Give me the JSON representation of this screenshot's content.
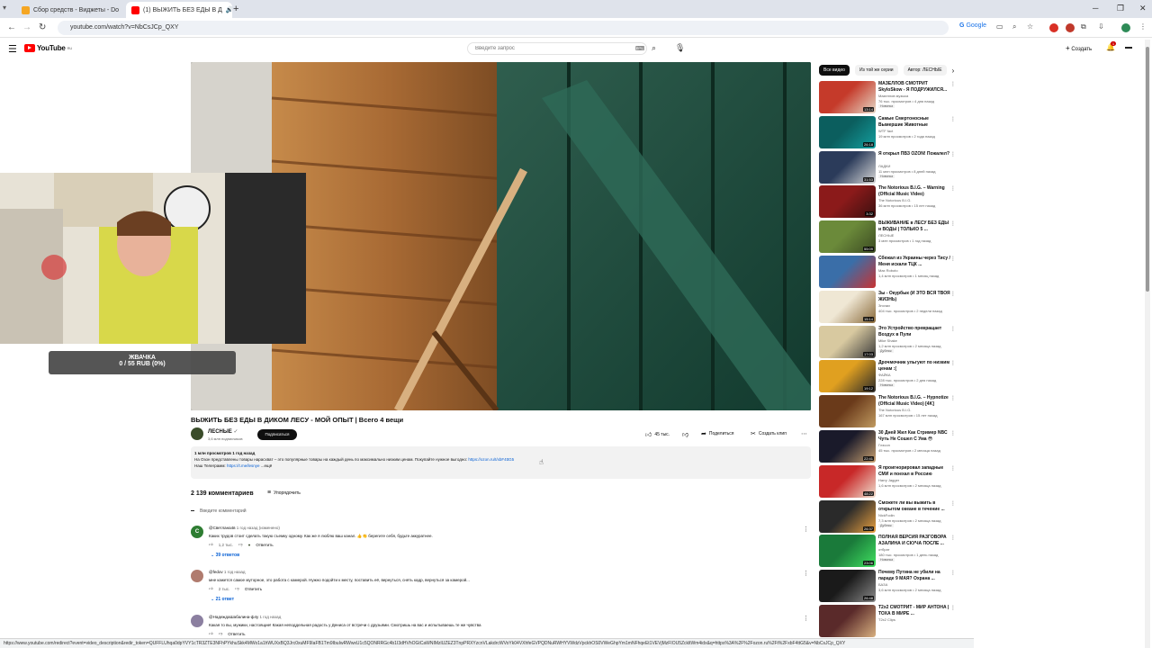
{
  "browser": {
    "tabs": [
      {
        "title": "Сбор средств - Виджеты - Do",
        "close": "×"
      },
      {
        "title": "(1) ВЫЖИТЬ БЕЗ ЕДЫ В Д",
        "close": "×"
      }
    ],
    "new_tab": "+",
    "url": "youtube.com/watch?v=NbCsJCp_QXY",
    "google_chip": "Google"
  },
  "yt_header": {
    "logo": "YouTube",
    "logo_region": "RU",
    "search_placeholder": "Введите запрос",
    "create_label": "Создать",
    "notif_count": "1"
  },
  "overlay": {
    "donation_title": "ЖВАЧКА",
    "donation_progress": "0 / 55 RUB (0%)"
  },
  "video": {
    "title": "ВЫЖИТЬ БЕЗ ЕДЫ В ДИКОМ ЛЕСУ - МОЙ ОПЫТ | Всего 4 вещи",
    "channel": "ЛЕСНЫЕ",
    "subs": "3,6 млн подписчиков",
    "subscribe": "Подписаться",
    "likes": "45 тыс.",
    "share": "Поделиться",
    "clip": "Создать клип",
    "desc_stats": "1 млн просмотров  1 год назад",
    "desc_line1": "На Озон представлены товары нарасхват – это популярные товары на каждый день по максимально низким ценам. Покупайте нужное выгодно:",
    "desc_link": "https://ozon.ru/t/xbF4ttG5",
    "desc_line2": "Наш Телеграмм:",
    "desc_link2": "https://t.me/lesnye",
    "desc_more": "...ещё"
  },
  "comments": {
    "count": "2 139 комментариев",
    "sort": "Упорядочить",
    "add_placeholder": "Введите комментарий",
    "items": [
      {
        "avatar": "С",
        "author": "@Светлана4в",
        "time": "1 год назад (изменено)",
        "text": "Каких трудов стоит сделать такую съемку одному. Как же я люблю ваш канал. 👍👏 берегите себя, будьте аккуратнее.",
        "likes": "1,2 тыс.",
        "reply": "Ответить",
        "replies": "39 ответов",
        "color": "#2e7d32"
      },
      {
        "avatar": "",
        "author": "@fedov",
        "time": "1 год назад",
        "text": "мне кажется самое муторное, это работа с камерой. Нужно подойти к месту, поставить её, вернуться, снять кадр, вернуться за камерой...",
        "likes": "2 тыс.",
        "reply": "Ответить",
        "replies": "21 ответ",
        "color": "#b07b6e"
      },
      {
        "avatar": "",
        "author": "@НадеждаШабалина-ф4у",
        "time": "1 год назад",
        "text": "Какая то вы, мужики, настоящие! Какая неподдельная радость у Дениса от встречи с друзьями. Смотришь на вас и испытываешь те же чувства",
        "likes": "",
        "reply": "Ответить",
        "replies": "",
        "color": "#8b7fa0"
      }
    ]
  },
  "sidebar": {
    "chips": [
      "Все видео",
      "Из той же серии",
      "Автор: ЛЕСНЫЕ"
    ],
    "videos": [
      {
        "title": "МАЗЕЛЛОВ СМОТРИТ SkyloSkow - Я ПОДРУЖИЛСЯ...",
        "channel": "Мазеллов музыка",
        "meta": "76 тыс. просмотров • 4 дня назад",
        "badge": "Новинка",
        "duration": "13:14",
        "c1": "#c53a2a",
        "c2": "#e6d9c7"
      },
      {
        "title": "Самые Смертоносные Вымершие Животные",
        "channel": "WTF fact",
        "meta": "19 млн просмотров • 2 года назад",
        "badge": "",
        "duration": "26:18",
        "c1": "#0b5e5e",
        "c2": "#14a0a0"
      },
      {
        "title": "Я открыл ПВЗ OZON! Пожалел?",
        "channel": "ЛАДКИ",
        "meta": "11 млн просмотров • 8 дней назад",
        "badge": "Новинка",
        "duration": "31:53",
        "c1": "#2b3b5a",
        "c2": "#d8d8d8"
      },
      {
        "title": "The Notorious B.I.G. – Warning (Official Music Video)",
        "channel": "The Notorious B.I.G.",
        "meta": "36 млн просмотров • 15 лет назад",
        "badge": "",
        "duration": "3:32",
        "c1": "#8b1a1a",
        "c2": "#3a1010"
      },
      {
        "title": "ВЫЖИВАНИЕ в ЛЕСУ БЕЗ ЕДЫ и ВОДЫ | ТОЛЬКО 5 ...",
        "channel": "ЛЕСНЫЕ",
        "meta": "3 млн просмотров • 1 год назад",
        "badge": "",
        "duration": "55:09",
        "c1": "#6b8a3a",
        "c2": "#3b4a22"
      },
      {
        "title": "Сбежал из Украины через Тису / Меня искали ТЦК ...",
        "channel": "Max Roboto",
        "meta": "1,4 млн просмотров • 1 месяц назад",
        "badge": "",
        "duration": "",
        "c1": "#3a6ea8",
        "c2": "#c83232"
      },
      {
        "title": "Зы - Окурбык (И ЭТО ВСЯ ТВОЯ ЖИЗНЬ)",
        "channel": "Зпочки",
        "meta": "404 тыс. просмотров • 2 недели назад",
        "badge": "",
        "duration": "15:14",
        "c1": "#efe7d4",
        "c2": "#8a6a3a"
      },
      {
        "title": "Это Устройство превращает Воздух в Пули",
        "channel": "Mike Shake",
        "meta": "1,2 млн просмотров • 2 месяца назад",
        "badge": "Дубляж",
        "duration": "17:03",
        "c1": "#d8c9a0",
        "c2": "#3a3a3a"
      },
      {
        "title": "Дрочмочник ульгуют по низким ценам :(",
        "channel": "ФАЙКА",
        "meta": "228 тыс. просмотров • 2 дня назад",
        "badge": "Новинка",
        "duration": "19:12",
        "c1": "#e0a020",
        "c2": "#2a2a2a"
      },
      {
        "title": "The Notorious B.I.G. – Hypnotize (Official Music Video) [4K]",
        "channel": "The Notorious B.I.G.",
        "meta": "167 млн просмотров • 15 лет назад",
        "badge": "",
        "duration": "",
        "c1": "#6a3a1a",
        "c2": "#c09a60"
      },
      {
        "title": "30 Дней Жил Как Стример NBC Чуть Не Сошел С Ума 😳",
        "channel": "Глэсон",
        "meta": "45 тыс. просмотров • 2 месяца назад",
        "badge": "",
        "duration": "22:41",
        "c1": "#1a1a2a",
        "c2": "#c8a070"
      },
      {
        "title": "Я проигнорировал западные СМИ и поехал в Россию",
        "channel": "Harry Jagger",
        "meta": "1,6 млн просмотров • 2 месяца назад",
        "badge": "",
        "duration": "48:22",
        "c1": "#c82828",
        "c2": "#f0e0d0"
      },
      {
        "title": "Сможете ли вы выжить в открытом океане в течение ...",
        "channel": "NickFodin",
        "meta": "7,3 млн просмотров • 2 месяца назад",
        "badge": "Дубляж",
        "duration": "26:37",
        "c1": "#2a2a2a",
        "c2": "#e8a040"
      },
      {
        "title": "ПОЛНАЯ ВЕРСИЯ РАЗГОВОРА АЗАЛИНА И СКУЧА ПОСЛЕ ...",
        "channel": "отбрат",
        "meta": "180 тыс. просмотров • 1 день назад",
        "badge": "Новинка",
        "duration": "23:06",
        "c1": "#1a7a3a",
        "c2": "#40e060"
      },
      {
        "title": "Почему Путина не убили на параде 9 МАЯ? Охрана ...",
        "channel": "БАЗА",
        "meta": "3,6 млн просмотров • 2 месяца назад",
        "badge": "",
        "duration": "26:48",
        "c1": "#1a1a1a",
        "c2": "#8a8a8a"
      },
      {
        "title": "T2x2 СМОТРИТ - МИР АНТОНА | ТОХА В МИРЕ ...",
        "channel": "T2x2 Clips",
        "meta": "",
        "badge": "",
        "duration": "",
        "c1": "#5a2a2a",
        "c2": "#d8b080"
      }
    ]
  },
  "statusbar": "https://www.youtube.com/redirect?event=video_description&redir_token=QUFFLUhqa0dpYVY1cTR3ZTE3NFhPYkhuSkk4MWo1a1hWUXxBQ3Jrc0xuMF9IaFB1Tm9IbuIwRWwxU1c5QONRRGc4b1I3dHVhOGtCaWNIMzlUZEZ3TnpPRXYzcnVLakdrcWVoYk04VXhfeGVPQDNuRWHYVWdzVpckhOS0VWeGhpYm1mNFhqeEt1VEVjMzFIOU5ZckltWm4idx&q=https%3A%2F%2Fozon.ru%2Ft%2FxbF4ttG5&v=NbCsJCp_QXY"
}
